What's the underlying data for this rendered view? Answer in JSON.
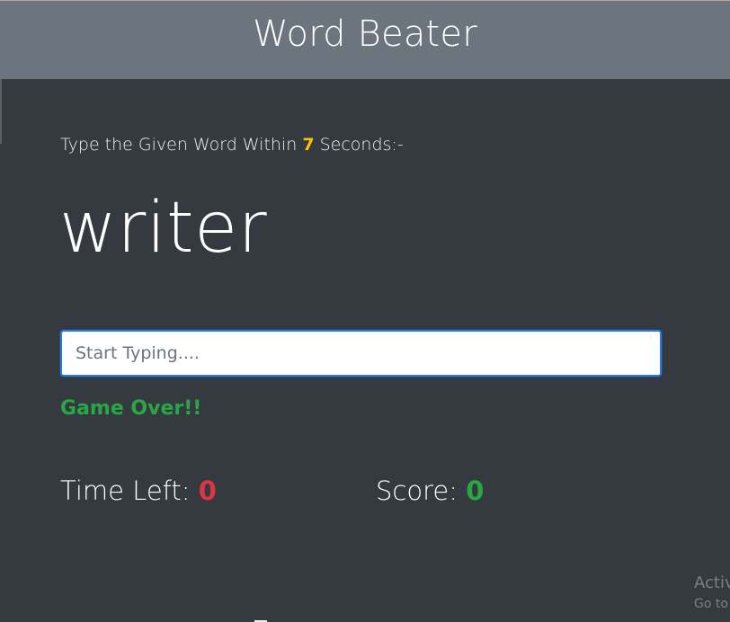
{
  "app": {
    "title": "Word Beater"
  },
  "game": {
    "instruction_prefix": "Type the Given Word Within",
    "seconds": "7",
    "instruction_suffix": "Seconds:-",
    "current_word": "writer",
    "input": {
      "placeholder": "Start Typing....",
      "value": ""
    },
    "message": "Game Over!!",
    "time_left_label": "Time Left:",
    "time_left_value": "0",
    "score_label": "Score:",
    "score_value": "0"
  },
  "system_overlay": {
    "line1": "Activ",
    "line2": "Go to"
  },
  "colors": {
    "background": "#343a40",
    "header": "#6c757d",
    "seconds": "#ffc107",
    "status": "#28a745",
    "time_left": "#dc3545",
    "score": "#28a745"
  }
}
